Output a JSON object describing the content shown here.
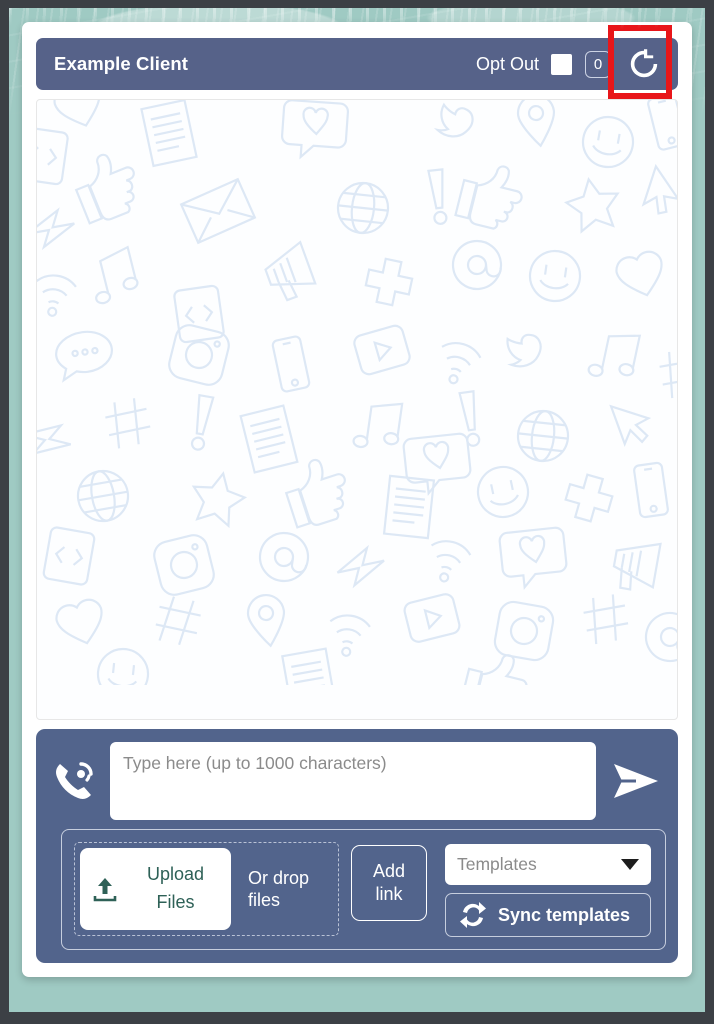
{
  "header": {
    "client_name": "Example Client",
    "opt_out_label": "Opt Out",
    "opt_out_checked": false,
    "unread_count": "0",
    "refresh_icon": "refresh-icon",
    "highlight_color": "#e8161a"
  },
  "conversation": {
    "messages": [],
    "watermark": "social-media-icons-pattern"
  },
  "composer": {
    "phone_icon": "phone-ring-icon",
    "message_placeholder": "Type here (up to 1000 characters)",
    "message_value": "",
    "send_icon": "send-paper-plane-icon"
  },
  "attachments": {
    "upload_label_line1": "Upload",
    "upload_label_line2": "Files",
    "upload_icon": "upload-arrow-icon",
    "drop_hint_line1": "Or drop",
    "drop_hint_line2": "files",
    "add_link_line1": "Add",
    "add_link_line2": "link"
  },
  "templates": {
    "select_placeholder": "Templates",
    "sync_label": "Sync templates",
    "sync_icon": "sync-arrows-icon",
    "caret_icon": "chevron-down-icon"
  },
  "theme": {
    "header_blue": "#566289",
    "panel_blue": "#52648c",
    "backdrop_teal": "#9fcac3",
    "frame_gray": "#3c4045",
    "upload_green": "#2e6157"
  }
}
